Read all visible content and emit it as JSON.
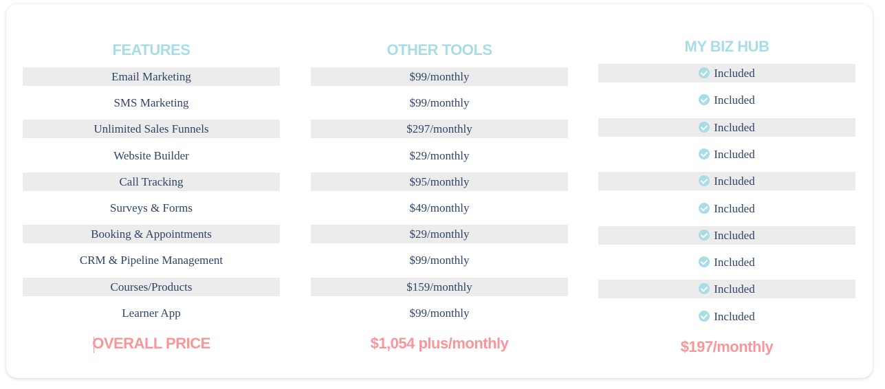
{
  "columns": {
    "features": {
      "header": "FEATURES",
      "rows": [
        "Email Marketing",
        "SMS Marketing",
        "Unlimited Sales Funnels",
        "Website Builder",
        "Call Tracking",
        "Surveys & Forms",
        "Booking & Appointments",
        "CRM & Pipeline Management",
        "Courses/Products",
        "Learner App"
      ],
      "total": "OVERALL PRICE"
    },
    "other_tools": {
      "header": "OTHER TOOLS",
      "rows": [
        "$99/monthly",
        "$99/monthly",
        "$297/monthly",
        "$29/monthly",
        "$95/monthly",
        "$49/monthly",
        "$29/monthly",
        "$99/monthly",
        "$159/monthly",
        "$99/monthly"
      ],
      "total": "$1,054 plus/monthly"
    },
    "my_biz_hub": {
      "header": "MY BIZ HUB",
      "rows": [
        "Included",
        "Included",
        "Included",
        "Included",
        "Included",
        "Included",
        "Included",
        "Included",
        "Included",
        "Included"
      ],
      "row_icon": "check-circle-icon",
      "total": "$197/monthly"
    }
  },
  "colors": {
    "header": "#a8dde6",
    "total": "#f7979a",
    "text": "#2f4468",
    "shade": "#ececec"
  }
}
